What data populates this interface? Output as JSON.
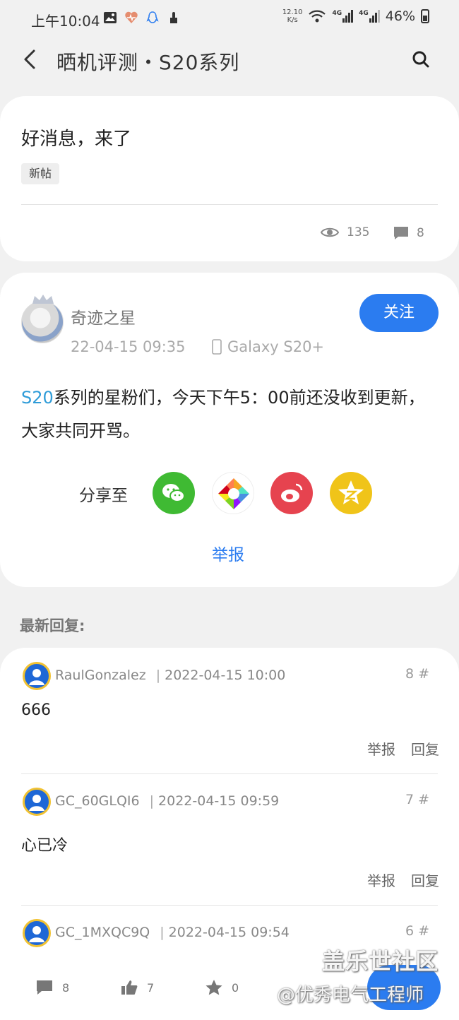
{
  "status_bar": {
    "time": "上午10:04",
    "net_speed_value": "12.10",
    "net_speed_unit": "K/s",
    "network_1": "4G",
    "network_2": "4G",
    "battery": "46%"
  },
  "header": {
    "title": "晒机评测・S20系列"
  },
  "topic": {
    "title": "好消息，来了",
    "tag": "新帖",
    "views": "135",
    "comments": "8"
  },
  "post": {
    "author": "奇迹之星",
    "time": "22-04-15 09:35",
    "device": "Galaxy S20+",
    "follow_label": "关注",
    "content_highlight": "S20",
    "content_rest": "系列的星粉们，今天下午5：00前还没收到更新，大家共同开骂。",
    "share_label": "分享至",
    "share_targets": [
      "wechat-icon",
      "moments-icon",
      "weibo-icon",
      "qzone-icon"
    ],
    "report_label": "举报"
  },
  "replies_section": {
    "label": "最新回复:",
    "replies": [
      {
        "user": "RaulGonzalez",
        "time": "2022-04-15 10:00",
        "floor": "8 #",
        "text": "666",
        "report": "举报",
        "reply": "回复"
      },
      {
        "user": "GC_60GLQI6",
        "time": "2022-04-15 09:59",
        "floor": "7 #",
        "text": "心已冷",
        "report": "举报",
        "reply": "回复"
      },
      {
        "user": "GC_1MXQC9Q",
        "time": "2022-04-15 09:54",
        "floor": "6 #"
      }
    ]
  },
  "bottom_bar": {
    "comments": "8",
    "likes": "7",
    "favorites": "0"
  },
  "watermark": {
    "line1": "盖乐世社区",
    "line2": "@优秀电气工程师"
  },
  "colors": {
    "accent": "#2b7cf0",
    "highlight_text": "#2f9cd8",
    "background": "#f1f1f1"
  }
}
